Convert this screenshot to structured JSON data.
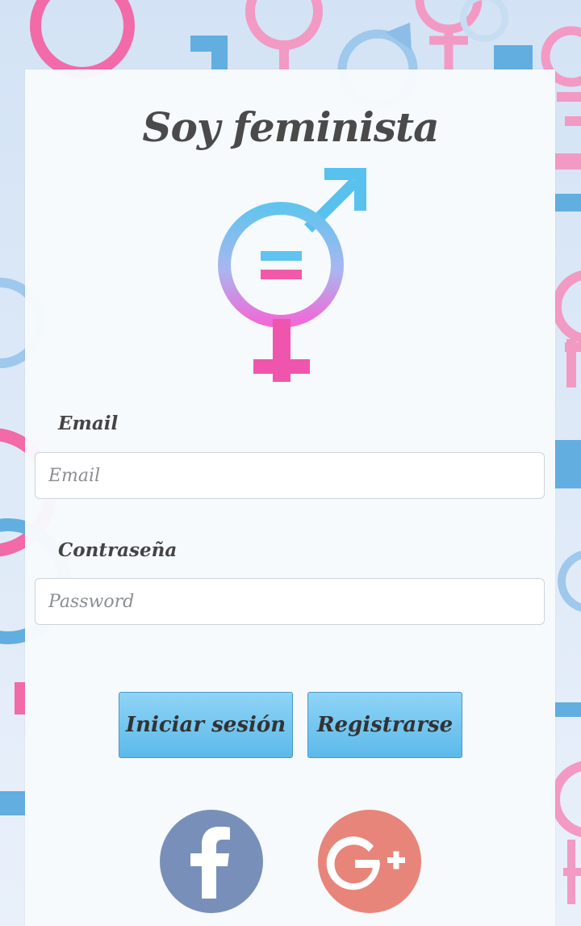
{
  "app": {
    "title": "Soy feminista"
  },
  "form": {
    "email_label": "Email",
    "email_placeholder": "Email",
    "email_value": "",
    "password_label": "Contraseña",
    "password_placeholder": "Password",
    "password_value": ""
  },
  "buttons": {
    "login": "Iniciar sesión",
    "register": "Registrarse"
  },
  "social": [
    {
      "icon": "facebook-icon",
      "color": "#7890b9"
    },
    {
      "icon": "google-plus-icon",
      "color": "#e8857a"
    }
  ],
  "colors": {
    "accent_blue": "#5cb9ea",
    "pink": "#f06ab4",
    "text": "#4a4a4a"
  }
}
